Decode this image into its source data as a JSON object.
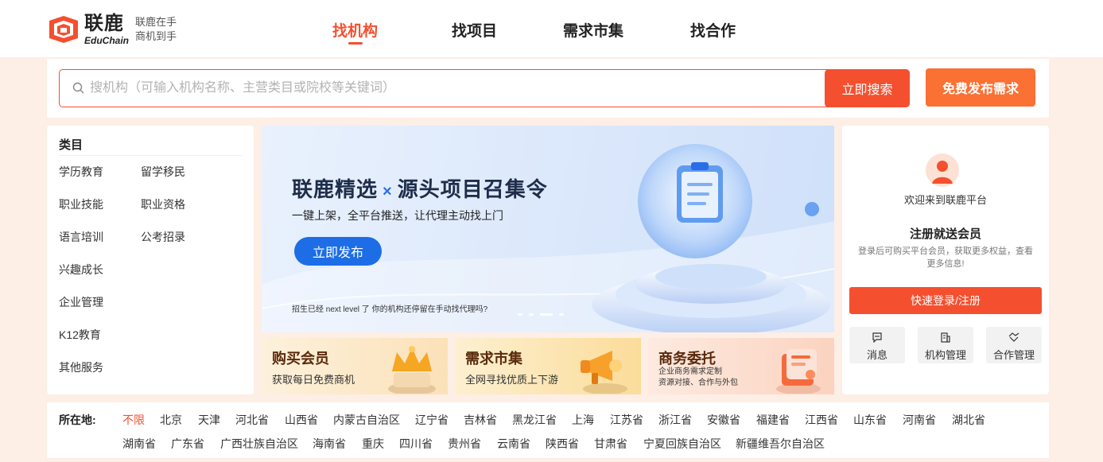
{
  "logo": {
    "cn": "联鹿",
    "en": "EduChain",
    "slogan_line1": "联鹿在手",
    "slogan_line2": "商机到手"
  },
  "nav": [
    "找机构",
    "找项目",
    "需求市集",
    "找合作"
  ],
  "search": {
    "placeholder": "搜机构（可输入机构名称、主营类目或院校等关键词）",
    "button": "立即搜索",
    "publish": "免费发布需求"
  },
  "categories": {
    "title": "类目",
    "items": [
      "学历教育",
      "留学移民",
      "职业技能",
      "职业资格",
      "语言培训",
      "公考招录",
      "兴趣成长",
      "企业管理",
      "K12教育",
      "其他服务"
    ]
  },
  "banner": {
    "title_left": "联鹿精选",
    "title_x": "×",
    "title_right": "源头项目召集令",
    "subtitle": "一键上架，全平台推送，让代理主动找上门",
    "button": "立即发布",
    "note": "招生已经 next level 了 你的机构还停留在手动找代理吗?"
  },
  "features": [
    {
      "title": "购买会员",
      "sub": "获取每日免费商机",
      "bg": "#fde7c7"
    },
    {
      "title": "需求市集",
      "sub": "全网寻找优质上下游",
      "bg": "#fde3b4"
    },
    {
      "title": "商务委托",
      "sub": "企业商务需求定制",
      "sub2": "资源对接、合作与外包",
      "bg": "#fde0d2"
    }
  ],
  "user": {
    "welcome": "欢迎来到联鹿平台",
    "reg_title": "注册就送会员",
    "reg_desc": "登录后可购买平台会员，获取更多权益，查看更多信息!",
    "login": "快速登录/注册",
    "quick": [
      {
        "label": "消息",
        "icon": "message-icon"
      },
      {
        "label": "机构管理",
        "icon": "building-icon"
      },
      {
        "label": "合作管理",
        "icon": "handshake-icon"
      }
    ]
  },
  "location": {
    "label": "所在地:",
    "row1": [
      "不限",
      "北京",
      "天津",
      "河北省",
      "山西省",
      "内蒙古自治区",
      "辽宁省",
      "吉林省",
      "黑龙江省",
      "上海",
      "江苏省",
      "浙江省",
      "安徽省",
      "福建省",
      "江西省",
      "山东省",
      "河南省",
      "湖北省"
    ],
    "row2": [
      "湖南省",
      "广东省",
      "广西壮族自治区",
      "海南省",
      "重庆",
      "四川省",
      "贵州省",
      "云南省",
      "陕西省",
      "甘肃省",
      "宁夏回族自治区",
      "新疆维吾尔自治区"
    ]
  },
  "colors": {
    "accent": "#f4502f",
    "orange": "#fb7033",
    "banner_blue": "#1d6ee6"
  }
}
